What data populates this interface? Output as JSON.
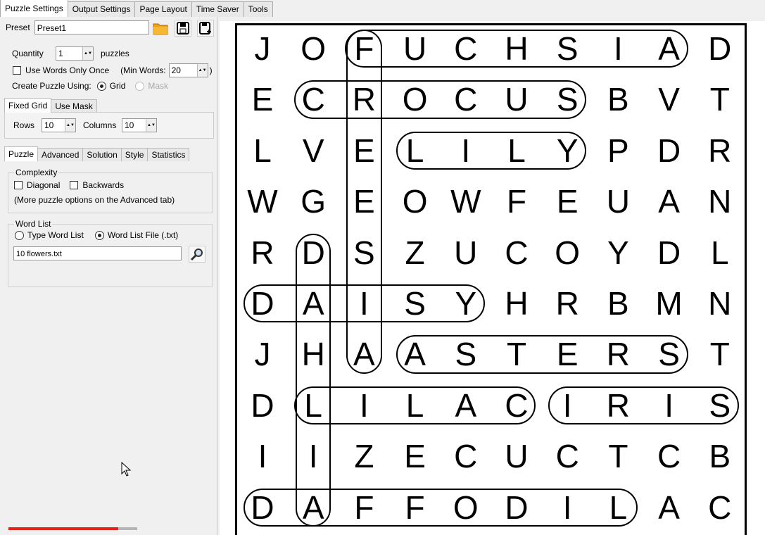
{
  "top_tabs": [
    "Puzzle Settings",
    "Output Settings",
    "Page Layout",
    "Time Saver",
    "Tools"
  ],
  "preset": {
    "label": "Preset",
    "value": "Preset1"
  },
  "quantity": {
    "label": "Quantity",
    "value": "1",
    "unit": "puzzles"
  },
  "use_words_once": {
    "label": "Use Words Only Once",
    "min_label": "(Min Words:",
    "min_value": "20",
    "close": ")"
  },
  "create_using": {
    "label": "Create Puzzle Using:",
    "grid": "Grid",
    "mask": "Mask"
  },
  "grid_tabs": [
    "Fixed Grid",
    "Use Mask"
  ],
  "rows": {
    "label": "Rows",
    "value": "10"
  },
  "columns": {
    "label": "Columns",
    "value": "10"
  },
  "inner_tabs": [
    "Puzzle",
    "Advanced",
    "Solution",
    "Style",
    "Statistics"
  ],
  "complexity": {
    "title": "Complexity",
    "diagonal": "Diagonal",
    "backwards": "Backwards",
    "note": "(More puzzle options on the Advanced tab)"
  },
  "word_list": {
    "title": "Word List",
    "type_option": "Type Word List",
    "file_option": "Word List File (.txt)",
    "file_value": "10 flowers.txt"
  },
  "grid": [
    [
      "J",
      "O",
      "F",
      "U",
      "C",
      "H",
      "S",
      "I",
      "A",
      "D"
    ],
    [
      "E",
      "C",
      "R",
      "O",
      "C",
      "U",
      "S",
      "B",
      "V",
      "T"
    ],
    [
      "L",
      "V",
      "E",
      "L",
      "I",
      "L",
      "Y",
      "P",
      "D",
      "R"
    ],
    [
      "W",
      "G",
      "E",
      "O",
      "W",
      "F",
      "E",
      "U",
      "A",
      "N"
    ],
    [
      "R",
      "D",
      "S",
      "Z",
      "U",
      "C",
      "O",
      "Y",
      "D",
      "L"
    ],
    [
      "D",
      "A",
      "I",
      "S",
      "Y",
      "H",
      "R",
      "B",
      "M",
      "N"
    ],
    [
      "J",
      "H",
      "A",
      "A",
      "S",
      "T",
      "E",
      "R",
      "S",
      "T"
    ],
    [
      "D",
      "L",
      "I",
      "L",
      "A",
      "C",
      "I",
      "R",
      "I",
      "S"
    ],
    [
      "I",
      "I",
      "Z",
      "E",
      "C",
      "U",
      "C",
      "T",
      "C",
      "B"
    ],
    [
      "D",
      "A",
      "F",
      "F",
      "O",
      "D",
      "I",
      "L",
      "A",
      "C"
    ]
  ],
  "found_words": [
    {
      "word": "FUCHSIA",
      "row": 0,
      "col": 2,
      "dir": "h",
      "len": 7
    },
    {
      "word": "CROCUS",
      "row": 1,
      "col": 1,
      "dir": "h",
      "len": 6
    },
    {
      "word": "LILY",
      "row": 2,
      "col": 3,
      "dir": "h",
      "len": 4
    },
    {
      "word": "DAISY",
      "row": 5,
      "col": 0,
      "dir": "h",
      "len": 5
    },
    {
      "word": "ASTERS",
      "row": 6,
      "col": 3,
      "dir": "h",
      "len": 6
    },
    {
      "word": "LILAC",
      "row": 7,
      "col": 1,
      "dir": "h",
      "len": 5
    },
    {
      "word": "IRIS",
      "row": 7,
      "col": 6,
      "dir": "h",
      "len": 4
    },
    {
      "word": "DAFFODIL",
      "row": 9,
      "col": 0,
      "dir": "h",
      "len": 8
    },
    {
      "word": "FREESIA",
      "row": 0,
      "col": 2,
      "dir": "v",
      "len": 7
    },
    {
      "word": "DAHLIA",
      "row": 4,
      "col": 1,
      "dir": "v",
      "len": 6
    }
  ],
  "video_progress": 0.85
}
